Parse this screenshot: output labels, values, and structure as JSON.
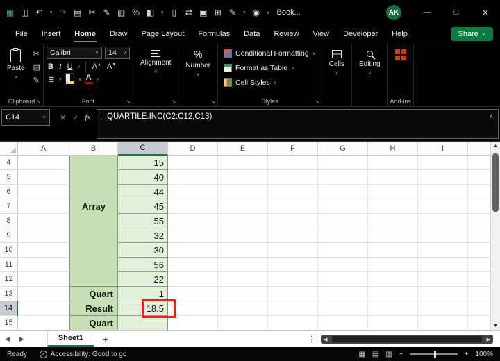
{
  "ui": {
    "chevron_down": "∨",
    "chevron_up": "∧",
    "arrow_up": "▲",
    "arrow_down": "▼",
    "arrow_left": "◀",
    "arrow_right": "▶",
    "minimize": "—",
    "maximize": "□",
    "close": "✕",
    "scissors": "✂",
    "copy": "▤",
    "brush": "✎",
    "borders": "⊞",
    "fill": "◧",
    "percent": "%",
    "launcher": "↘",
    "ellipsis_v": "⋮",
    "cancel": "✕",
    "check": "✓",
    "fx": "fx",
    "plus": "+",
    "minus": "−",
    "acc_check": "✓",
    "view_normal": "▦",
    "view_layout": "▤",
    "view_break": "▥"
  },
  "titlebar": {
    "workbook_name": "Book...",
    "avatar_initials": "AK",
    "qat_icons": [
      {
        "name": "excel-app-icon",
        "glyph": "▦"
      },
      {
        "name": "save-icon",
        "glyph": "◫"
      },
      {
        "name": "undo-icon",
        "glyph": "↶"
      },
      {
        "name": "redo-icon",
        "glyph": "↷"
      },
      {
        "name": "copy-icon",
        "glyph": "▤"
      },
      {
        "name": "cut-icon",
        "glyph": "✂"
      },
      {
        "name": "format-painter-icon",
        "glyph": "✎"
      },
      {
        "name": "paste-icon",
        "glyph": "▥"
      },
      {
        "name": "percent-icon",
        "glyph": "%"
      },
      {
        "name": "fill-color-icon",
        "glyph": "◧"
      },
      {
        "name": "new-file-icon",
        "glyph": "▯"
      },
      {
        "name": "switch-windows-icon",
        "glyph": "⇄"
      },
      {
        "name": "camera-icon",
        "glyph": "▣"
      },
      {
        "name": "table-icon",
        "glyph": "⊞"
      },
      {
        "name": "ink-pen-icon",
        "glyph": "✎"
      },
      {
        "name": "record-macro-icon",
        "glyph": "◉"
      }
    ]
  },
  "menubar": {
    "items": [
      {
        "label": "File"
      },
      {
        "label": "Insert"
      },
      {
        "label": "Home"
      },
      {
        "label": "Draw"
      },
      {
        "label": "Page Layout"
      },
      {
        "label": "Formulas"
      },
      {
        "label": "Data"
      },
      {
        "label": "Review"
      },
      {
        "label": "View"
      },
      {
        "label": "Developer"
      },
      {
        "label": "Help"
      }
    ],
    "share_label": "Share"
  },
  "ribbon": {
    "paste_label": "Paste",
    "clipboard_label": "Clipboard",
    "font_name": "Calibri",
    "font_size": "14",
    "bold": "B",
    "italic": "I",
    "underline": "U",
    "font_letter": "A",
    "font_label": "Font",
    "alignment_label": "Alignment",
    "number_label": "Number",
    "styles": [
      {
        "label": "Conditional Formatting"
      },
      {
        "label": "Format as Table"
      },
      {
        "label": "Cell Styles"
      }
    ],
    "styles_label": "Styles",
    "cells_label": "Cells",
    "editing_label": "Editing",
    "addins_label": "Add-ins"
  },
  "formula_bar": {
    "name_box": "C14",
    "formula": "=QUARTILE.INC(C2:C12,C13)"
  },
  "grid": {
    "columns": [
      "A",
      "B",
      "C",
      "D",
      "E",
      "F",
      "G",
      "H",
      "I"
    ],
    "merged_b_label": "Array",
    "rows": [
      {
        "n": "4",
        "b": "",
        "c": "15"
      },
      {
        "n": "5",
        "b": "",
        "c": "40"
      },
      {
        "n": "6",
        "b": "",
        "c": "44"
      },
      {
        "n": "7",
        "b": "",
        "c": "45"
      },
      {
        "n": "8",
        "b": "",
        "c": "55"
      },
      {
        "n": "9",
        "b": "",
        "c": "32"
      },
      {
        "n": "10",
        "b": "",
        "c": "30"
      },
      {
        "n": "11",
        "b": "",
        "c": "56"
      },
      {
        "n": "12",
        "b": "",
        "c": "22"
      },
      {
        "n": "13",
        "b": "Quart",
        "c": "1"
      },
      {
        "n": "14",
        "b": "Result",
        "c": "18.5"
      },
      {
        "n": "15",
        "b": "Quart",
        "c": ""
      }
    ]
  },
  "sheetbar": {
    "active_tab": "Sheet1"
  },
  "statusbar": {
    "mode": "Ready",
    "accessibility": "Accessibility: Good to go",
    "zoom": "100%"
  }
}
